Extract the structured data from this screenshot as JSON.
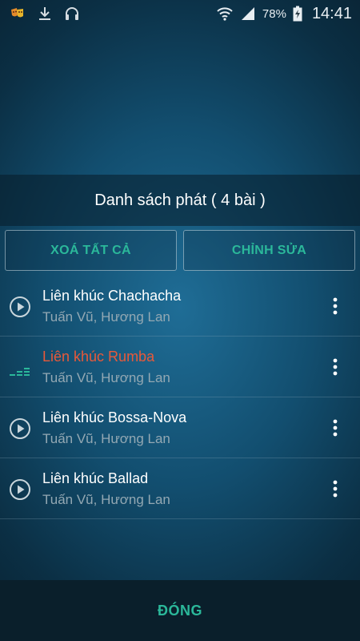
{
  "status_bar": {
    "battery_percent": "78%",
    "time": "14:41",
    "icons": [
      "app-notification-icon",
      "download-icon",
      "headphones-icon",
      "wifi-icon",
      "signal-icon",
      "battery-charging-icon"
    ]
  },
  "playlist": {
    "title": "Danh sách phát ( 4 bài )"
  },
  "actions": {
    "clear_all_label": "XOÁ TẤT CẢ",
    "edit_label": "CHỈNH SỬA"
  },
  "tracks": [
    {
      "title": "Liên khúc Chachacha",
      "artist": "Tuấn Vũ, Hương Lan",
      "state": "play-icon"
    },
    {
      "title": "Liên khúc Rumba",
      "artist": "Tuấn Vũ, Hương Lan",
      "state": "now-playing-equalizer-icon"
    },
    {
      "title": "Liên khúc Bossa-Nova",
      "artist": "Tuấn Vũ, Hương Lan",
      "state": "play-icon"
    },
    {
      "title": "Liên khúc Ballad",
      "artist": "Tuấn Vũ, Hương Lan",
      "state": "play-icon"
    }
  ],
  "bottom": {
    "close_label": "ĐÓNG"
  },
  "colors": {
    "accent": "#2bb89a",
    "now_playing": "#e8593a",
    "secondary_text": "#93a8b3"
  }
}
